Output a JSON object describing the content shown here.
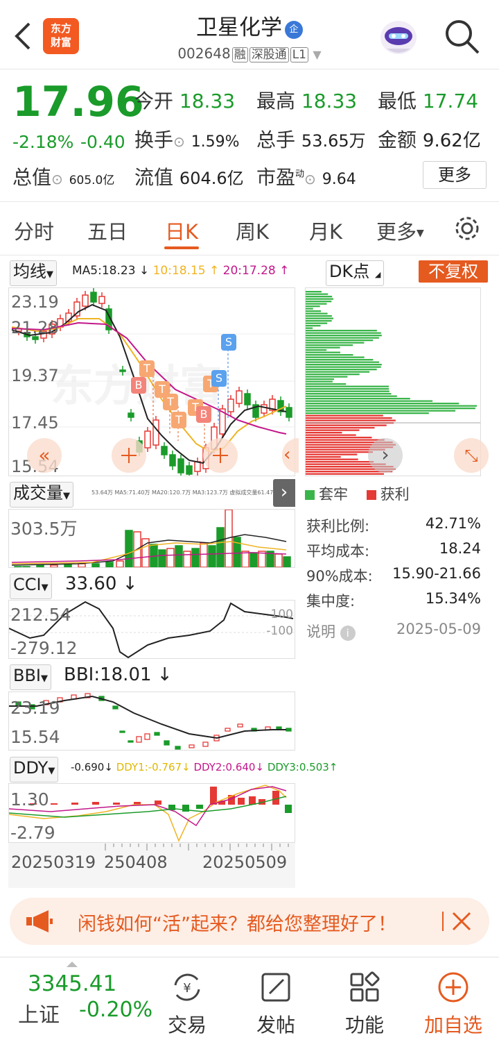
{
  "header": {
    "logo_text_1": "东方",
    "logo_text_2": "财富",
    "stock_name": "卫星化学",
    "enterprise_badge": "企",
    "stock_code": "002648",
    "tag_margin": "融",
    "tag_connect": "深股通",
    "tag_level": "L1",
    "back_icon": "chevron-left-icon",
    "search_icon": "search-icon",
    "avatar_icon": "robot-avatar-icon"
  },
  "quote": {
    "price": "17.96",
    "change_pct": "-2.18%",
    "change_amt": "-0.40",
    "open_label": "今开",
    "open_value": "18.33",
    "high_label": "最高",
    "high_value": "18.33",
    "low_label": "最低",
    "low_value": "17.74",
    "turnover_label": "换手",
    "turnover_value": "1.59%",
    "volume_label": "总手",
    "volume_value": "53.65万",
    "amount_label": "金额",
    "amount_value": "9.62亿",
    "mktcap_label": "总值",
    "mktcap_value": "605.0亿",
    "float_label": "流值",
    "float_value": "604.6亿",
    "pe_label": "市盈",
    "pe_superscript": "动",
    "pe_value": "9.64",
    "more_label": "更多"
  },
  "tabs": [
    {
      "label": "分时"
    },
    {
      "label": "五日"
    },
    {
      "label": "日K"
    },
    {
      "label": "周K"
    },
    {
      "label": "月K"
    },
    {
      "label": "更多"
    }
  ],
  "kline": {
    "ma_selector": "均线",
    "ma5": "MA5:18.23",
    "ma10": "10:18.15",
    "ma20": "20:17.28",
    "dk_selector": "DK点",
    "adjust_label": "不复权",
    "y_labels": [
      "23.19",
      "21.28",
      "19.37",
      "17.45",
      "15.54"
    ],
    "watermark": "东方财富"
  },
  "chips": {
    "legend_locked": "套牢",
    "legend_profit": "获利",
    "profit_ratio_label": "获利比例:",
    "profit_ratio_value": "42.71%",
    "avg_cost_label": "平均成本:",
    "avg_cost_value": "18.24",
    "cost90_label": "90%成本:",
    "cost90_value": "15.90-21.66",
    "concentration_label": "集中度:",
    "concentration_value": "15.34%",
    "note_label": "说明",
    "date": "2025-05-09"
  },
  "volume": {
    "selector": "成交量",
    "legend": "53.64万  MA5:71.40万  MA20:120.7万  MA3:123.7万  虚拟成交量61.47万",
    "y_label": "303.5万"
  },
  "cci": {
    "selector": "CCI",
    "value": "33.60",
    "y_top": "212.54",
    "y_bottom": "-279.12",
    "ref_100": "100",
    "ref_neg100": "-100"
  },
  "bbi": {
    "selector": "BBI",
    "value": "BBI:18.01",
    "y_top": "23.19",
    "y_bottom": "15.54"
  },
  "ddy": {
    "selector": "DDY",
    "value": "-0.690",
    "ddy1": "DDY1:-0.767",
    "ddy2": "DDY2:0.640",
    "ddy3": "DDY3:0.503",
    "y_top": "1.30",
    "y_bottom": "-2.79"
  },
  "x_axis": {
    "left": "20250319",
    "mid": "250408",
    "right": "20250509"
  },
  "ad": {
    "text": "闲钱如何“活”起来？都给您整理好了！"
  },
  "bottom_nav": {
    "index_value": "3345.41",
    "index_name": "上证",
    "index_change": "-0.20%",
    "trade": "交易",
    "post": "发帖",
    "function": "功能",
    "add_watch": "加自选"
  },
  "colors": {
    "up": "#e53935",
    "down": "#1a9b2a",
    "accent": "#e55a1f",
    "ma5": "#222222",
    "ma10": "#f0b323",
    "ma20": "#c2178a"
  }
}
